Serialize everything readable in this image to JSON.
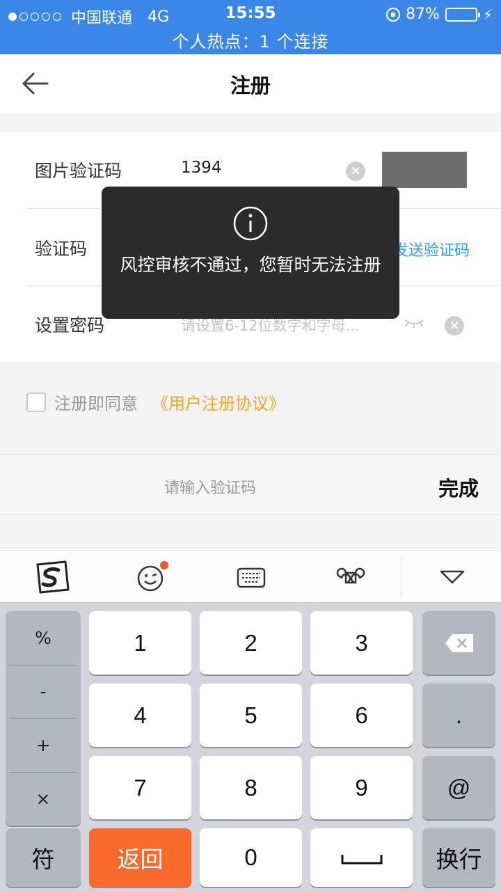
{
  "status_bar": {
    "carrier": "中国联通",
    "network": "4G",
    "time": "15:55",
    "battery": "87%",
    "battery_level": 0.87,
    "hotspot": "个人热点：1 个连接"
  },
  "nav": {
    "title": "注册"
  },
  "form": {
    "image_captcha": {
      "label": "图片验证码",
      "value": "1394"
    },
    "sms_code": {
      "label": "验证码",
      "send_label": "发送验证码"
    },
    "password": {
      "label": "设置密码",
      "placeholder": "请设置6-12位数字和字母..."
    }
  },
  "agreement": {
    "text": "注册即同意",
    "link": "《用户注册协议》"
  },
  "accessory": {
    "placeholder": "请输入验证码",
    "done": "完成"
  },
  "toast": {
    "message": "风控审核不通过，您暂时无法注册"
  },
  "keyboard": {
    "symbols": [
      "%",
      "-",
      "+",
      "×"
    ],
    "digits": [
      "1",
      "2",
      "3",
      "4",
      "5",
      "6",
      "7",
      "8",
      "9",
      "0"
    ],
    "dot": ".",
    "at": "@",
    "fu": "符",
    "back": "返回",
    "enter": "换行"
  },
  "colors": {
    "status_bar": "#3b87e8",
    "link_blue": "#2a9df4",
    "agreement_orange": "#f5a623",
    "back_key": "#f96a2c"
  }
}
